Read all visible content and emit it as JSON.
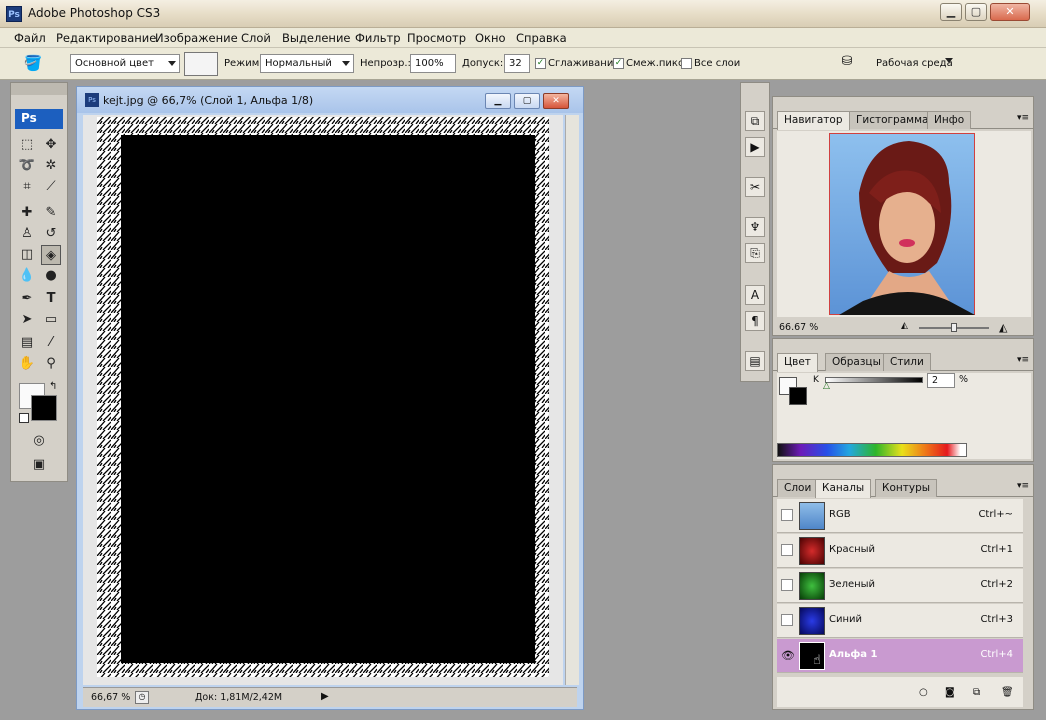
{
  "app": {
    "title": "Adobe Photoshop CS3",
    "logo": "Ps"
  },
  "window_controls": {
    "minimize": "▁",
    "maximize": "▢",
    "close": "✕"
  },
  "menu": [
    "Файл",
    "Редактирование",
    "Изображение",
    "Слой",
    "Выделение",
    "Фильтр",
    "Просмотр",
    "Окно",
    "Справка"
  ],
  "options": {
    "source_value": "Основной цвет",
    "mode_label": "Режим:",
    "mode_value": "Нормальный",
    "opacity_label": "Непрозр.:",
    "opacity_value": "100%",
    "tolerance_label": "Допуск:",
    "tolerance_value": "32",
    "antialias_label": "Сглаживание",
    "contiguous_label": "Смеж.пикс",
    "all_layers_label": "Все слои",
    "workspace_label": "Рабочая среда"
  },
  "toolbox": {
    "logo": "Ps"
  },
  "document": {
    "title": "kejt.jpg @ 66,7% (Слой 1, Альфа 1/8)",
    "zoom": "66,67 %",
    "doc_info": "Док: 1,81M/2,42M"
  },
  "navigator": {
    "tabs": [
      "Навигатор",
      "Гистограмма",
      "Инфо"
    ],
    "zoom": "66.67 %"
  },
  "color": {
    "tabs": [
      "Цвет",
      "Образцы",
      "Стили"
    ],
    "channel_label": "K",
    "value": "2",
    "unit": "%"
  },
  "channels": {
    "tabs": [
      "Слои",
      "Каналы",
      "Контуры"
    ],
    "rows": [
      {
        "name": "RGB",
        "shortcut": "Ctrl+~"
      },
      {
        "name": "Красный",
        "shortcut": "Ctrl+1"
      },
      {
        "name": "Зеленый",
        "shortcut": "Ctrl+2"
      },
      {
        "name": "Синий",
        "shortcut": "Ctrl+3"
      },
      {
        "name": "Альфа 1",
        "shortcut": "Ctrl+4"
      }
    ]
  },
  "colors": {
    "active_channel": "#c99ad0",
    "ps_blue": "#1c5fbf"
  }
}
